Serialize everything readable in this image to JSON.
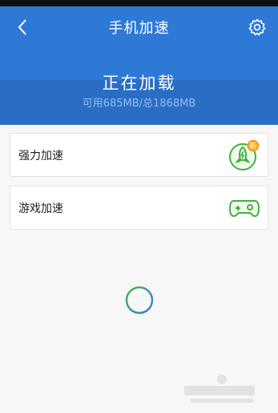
{
  "header": {
    "title": "手机加速",
    "status_title": "正在加载",
    "memory_text": "可用685MB/总1868MB"
  },
  "cards": [
    {
      "label": "强力加速",
      "icon": "rocket-icon",
      "badge": "新"
    },
    {
      "label": "游戏加速",
      "icon": "gamepad-icon"
    }
  ],
  "colors": {
    "header_blue": "#2f79d6",
    "badge_orange": "#f5a623",
    "icon_green": "#3db23b"
  }
}
